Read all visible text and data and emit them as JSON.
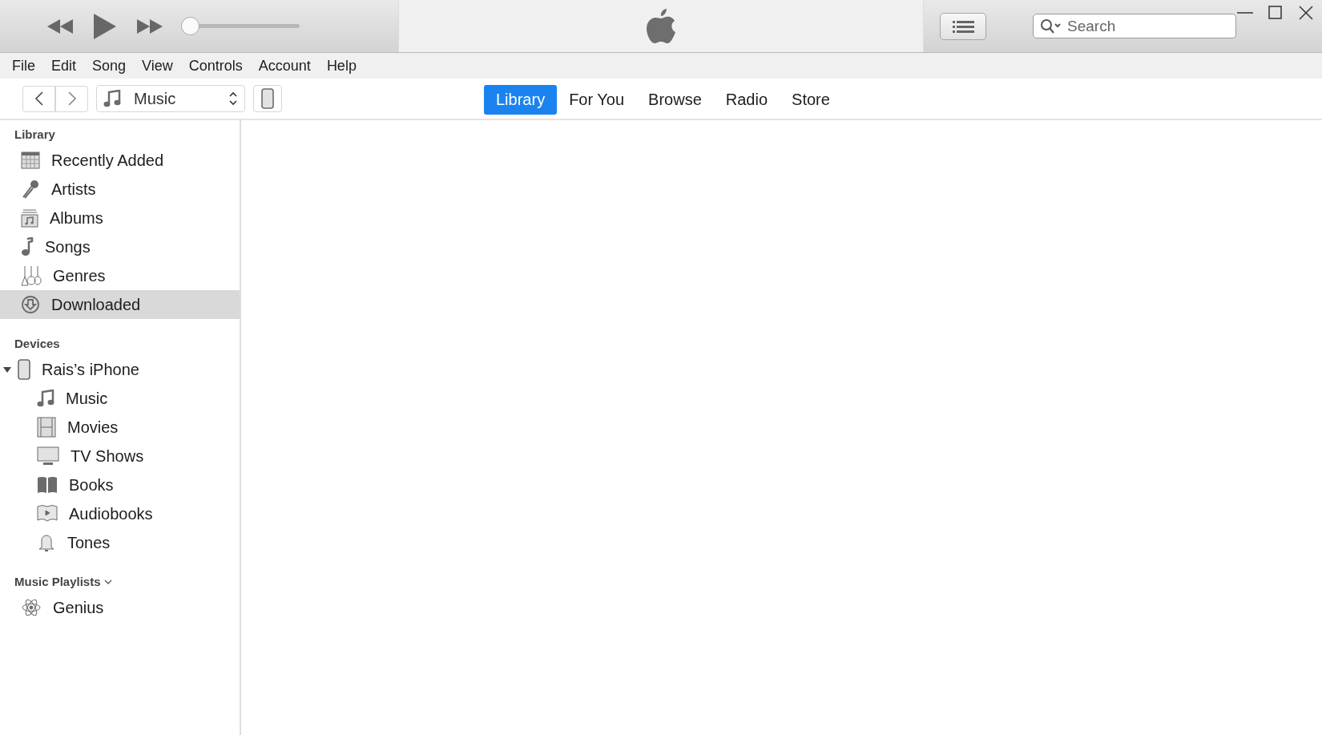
{
  "player": {
    "volume": {
      "level": 0
    }
  },
  "search": {
    "placeholder": "Search"
  },
  "menu": [
    "File",
    "Edit",
    "Song",
    "View",
    "Controls",
    "Account",
    "Help"
  ],
  "media_picker": {
    "value": "Music"
  },
  "tabs": [
    {
      "label": "Library",
      "selected": true
    },
    {
      "label": "For You",
      "selected": false
    },
    {
      "label": "Browse",
      "selected": false
    },
    {
      "label": "Radio",
      "selected": false
    },
    {
      "label": "Store",
      "selected": false
    }
  ],
  "sidebar": {
    "sections": [
      {
        "title": "Library",
        "items": [
          {
            "label": "Recently Added",
            "selected": false
          },
          {
            "label": "Artists",
            "selected": false
          },
          {
            "label": "Albums",
            "selected": false
          },
          {
            "label": "Songs",
            "selected": false
          },
          {
            "label": "Genres",
            "selected": false
          },
          {
            "label": "Downloaded",
            "selected": true
          }
        ]
      },
      {
        "title": "Devices",
        "items": [
          {
            "label": "Rais’s iPhone",
            "selected": false,
            "expanded": true,
            "children": [
              {
                "label": "Music",
                "selected": false
              },
              {
                "label": "Movies",
                "selected": false
              },
              {
                "label": "TV Shows",
                "selected": false
              },
              {
                "label": "Books",
                "selected": false
              },
              {
                "label": "Audiobooks",
                "selected": false
              },
              {
                "label": "Tones",
                "selected": false
              }
            ]
          }
        ]
      },
      {
        "title": "Music Playlists",
        "dropdown": true,
        "items": [
          {
            "label": "Genius",
            "selected": false
          }
        ]
      }
    ]
  }
}
